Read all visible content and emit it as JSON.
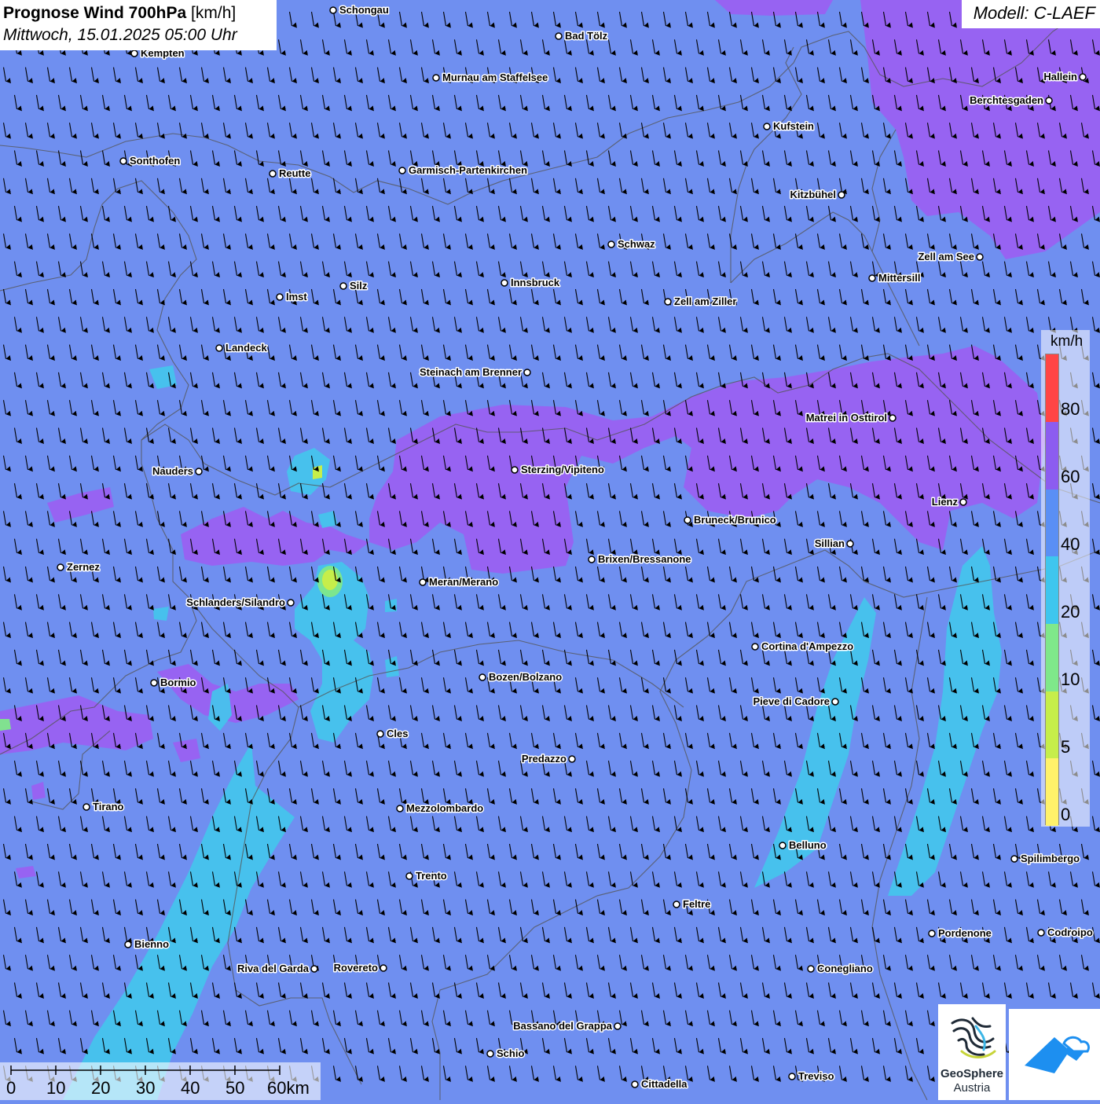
{
  "header": {
    "title_bold": "Prognose Wind 700hPa",
    "title_unit": "[km/h]",
    "date": "Mittwoch, 15.01.2025 05:00 Uhr"
  },
  "model_label": "Modell: C-LAEF",
  "legend": {
    "unit": "km/h",
    "ticks": [
      "80",
      "60",
      "40",
      "20",
      "10",
      "5",
      "0"
    ],
    "colors": [
      "#ff4545",
      "#8c5cf0",
      "#5a8ff5",
      "#3ec6ee",
      "#7fe88a",
      "#c6ee4a",
      "#fff26a"
    ]
  },
  "map": {
    "background_color": "#6f8ff0",
    "purple_color": "#9b5ef2",
    "cyan_color": "#43c6ec",
    "wind_direction": "N"
  },
  "scalebar": {
    "labels": [
      "0",
      "10",
      "20",
      "30",
      "40",
      "50",
      "60km"
    ]
  },
  "cities": [
    {
      "name": "Schongau"
    },
    {
      "name": "Bad Tölz"
    },
    {
      "name": "Kempten"
    },
    {
      "name": "Murnau am Staffelsee"
    },
    {
      "name": "Hallein"
    },
    {
      "name": "Berchtesgaden"
    },
    {
      "name": "Kufstein"
    },
    {
      "name": "Sonthofen"
    },
    {
      "name": "Reutte"
    },
    {
      "name": "Garmisch-Partenkirchen"
    },
    {
      "name": "Kitzbühel"
    },
    {
      "name": "Schwaz"
    },
    {
      "name": "Zell am See"
    },
    {
      "name": "Mittersill"
    },
    {
      "name": "Innsbruck"
    },
    {
      "name": "Silz"
    },
    {
      "name": "Imst"
    },
    {
      "name": "Zell am Ziller"
    },
    {
      "name": "Landeck"
    },
    {
      "name": "Steinach am Brenner"
    },
    {
      "name": "Matrei in Osttirol"
    },
    {
      "name": "Nauders"
    },
    {
      "name": "Sterzing/Vipiteno"
    },
    {
      "name": "Lienz"
    },
    {
      "name": "Bruneck/Brunico"
    },
    {
      "name": "Sillian"
    },
    {
      "name": "Brixen/Bressanone"
    },
    {
      "name": "Zernez"
    },
    {
      "name": "Meran/Merano"
    },
    {
      "name": "Schlanders/Silandro"
    },
    {
      "name": "Cortina d'Ampezzo"
    },
    {
      "name": "Bozen/Bolzano"
    },
    {
      "name": "Bormio"
    },
    {
      "name": "Pieve di Cadore"
    },
    {
      "name": "Cles"
    },
    {
      "name": "Predazzo"
    },
    {
      "name": "Tirano"
    },
    {
      "name": "Mezzolombardo"
    },
    {
      "name": "Belluno"
    },
    {
      "name": "Spilimbergo"
    },
    {
      "name": "Trento"
    },
    {
      "name": "Feltre"
    },
    {
      "name": "Bienno"
    },
    {
      "name": "Pordenone"
    },
    {
      "name": "Codroipo"
    },
    {
      "name": "Riva del Garda"
    },
    {
      "name": "Rovereto"
    },
    {
      "name": "Conegliano"
    },
    {
      "name": "Bassano del Grappa"
    },
    {
      "name": "Schio"
    },
    {
      "name": "Treviso"
    },
    {
      "name": "Cittadella"
    }
  ],
  "logo": {
    "name": "GeoSphere",
    "sub": "Austria"
  }
}
